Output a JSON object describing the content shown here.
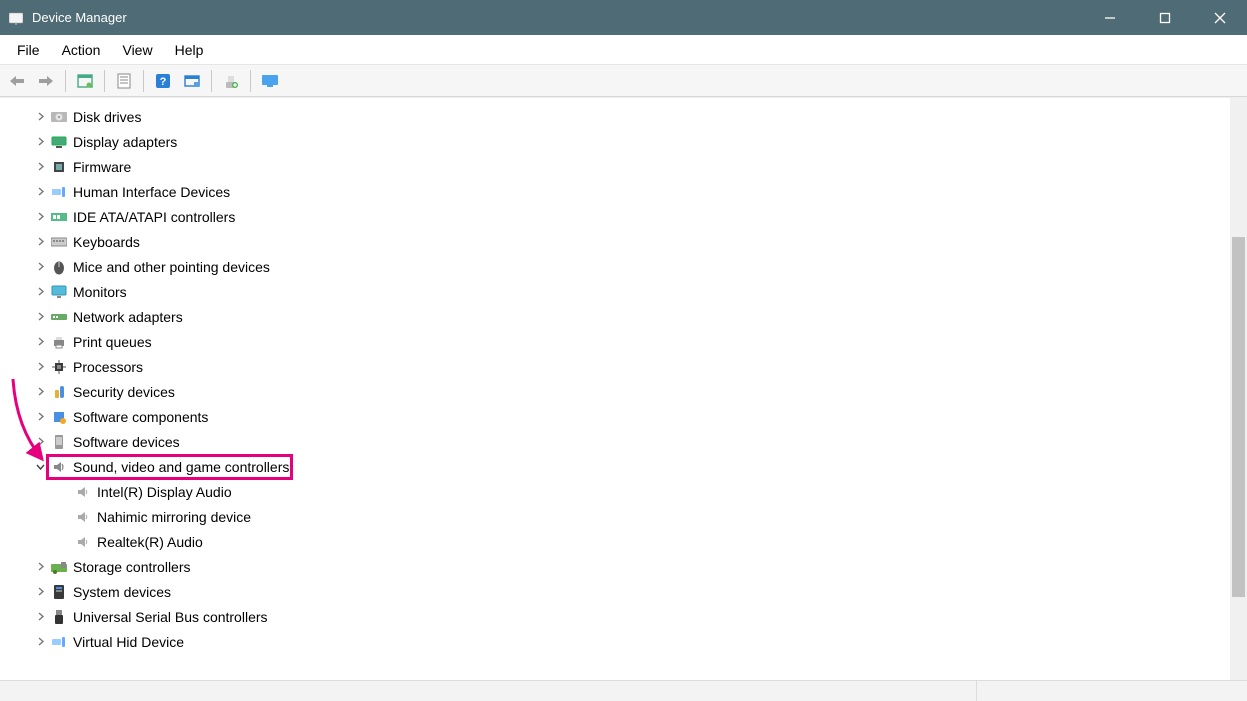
{
  "window": {
    "title": "Device Manager"
  },
  "menu": {
    "file": "File",
    "action": "Action",
    "view": "View",
    "help": "Help"
  },
  "tree": {
    "items": [
      {
        "icon": "disk-icon",
        "label": "Disk drives"
      },
      {
        "icon": "display-icon",
        "label": "Display adapters"
      },
      {
        "icon": "firmware-icon",
        "label": "Firmware"
      },
      {
        "icon": "hid-icon",
        "label": "Human Interface Devices"
      },
      {
        "icon": "ide-icon",
        "label": "IDE ATA/ATAPI controllers"
      },
      {
        "icon": "keyboard-icon",
        "label": "Keyboards"
      },
      {
        "icon": "mouse-icon",
        "label": "Mice and other pointing devices"
      },
      {
        "icon": "monitor-icon",
        "label": "Monitors"
      },
      {
        "icon": "network-icon",
        "label": "Network adapters"
      },
      {
        "icon": "printer-icon",
        "label": "Print queues"
      },
      {
        "icon": "cpu-icon",
        "label": "Processors"
      },
      {
        "icon": "security-icon",
        "label": "Security devices"
      },
      {
        "icon": "component-icon",
        "label": "Software components"
      },
      {
        "icon": "software-icon",
        "label": "Software devices"
      },
      {
        "icon": "sound-icon",
        "label": "Sound, video and game controllers",
        "expanded": true,
        "children": [
          {
            "icon": "speaker-icon",
            "label": "Intel(R) Display Audio"
          },
          {
            "icon": "speaker-icon",
            "label": "Nahimic mirroring device"
          },
          {
            "icon": "speaker-icon",
            "label": "Realtek(R) Audio"
          }
        ]
      },
      {
        "icon": "storage-icon",
        "label": "Storage controllers"
      },
      {
        "icon": "system-icon",
        "label": "System devices"
      },
      {
        "icon": "usb-icon",
        "label": "Universal Serial Bus controllers"
      },
      {
        "icon": "hid-icon",
        "label": "Virtual Hid Device"
      }
    ]
  },
  "annotation": {
    "highlighted_item": "Sound, video and game controllers",
    "highlight_color": "#e6007e"
  }
}
